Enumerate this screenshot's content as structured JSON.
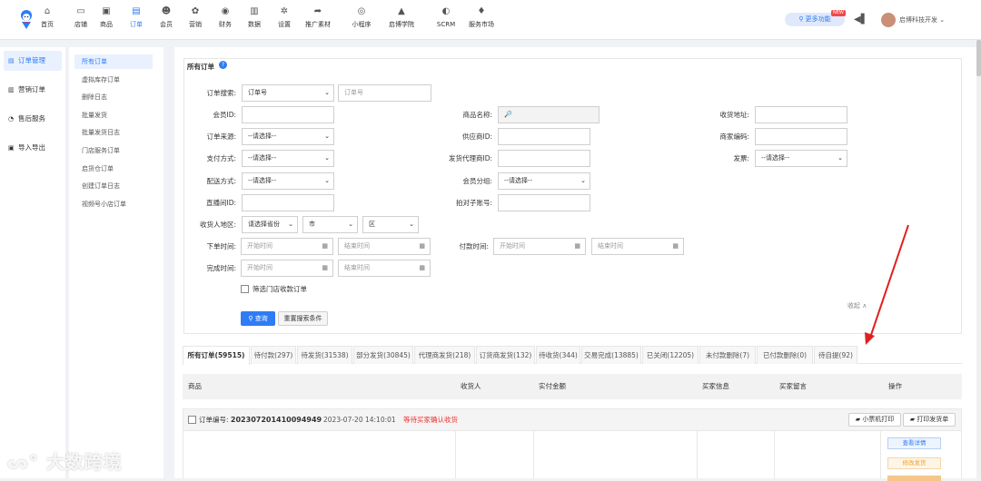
{
  "brand_colors": {
    "primary": "#2e7cf6",
    "danger": "#e33333",
    "warning": "#f0a020"
  },
  "topnav": [
    {
      "label": "首页",
      "icon": "home-icon"
    },
    {
      "label": "店铺",
      "icon": "store-icon"
    },
    {
      "label": "商品",
      "icon": "goods-icon"
    },
    {
      "label": "订单",
      "icon": "order-icon",
      "active": true
    },
    {
      "label": "会员",
      "icon": "member-icon"
    },
    {
      "label": "营销",
      "icon": "marketing-icon"
    },
    {
      "label": "财务",
      "icon": "finance-icon"
    },
    {
      "label": "数据",
      "icon": "chart-icon"
    },
    {
      "label": "设置",
      "icon": "gear-icon"
    },
    {
      "label": "推广素材",
      "icon": "share-icon"
    },
    {
      "label": "小程序",
      "icon": "miniapp-icon"
    },
    {
      "label": "启博学院",
      "icon": "academy-icon"
    },
    {
      "label": "SCRM",
      "icon": "scrm-icon"
    },
    {
      "label": "服务市场",
      "icon": "market-icon"
    }
  ],
  "header": {
    "more_features": "更多功能",
    "new_badge": "NEW",
    "user": "启博科技开发"
  },
  "leftmenu": [
    {
      "label": "订单管理",
      "active": true
    },
    {
      "label": "营销订单"
    },
    {
      "label": "售后服务"
    },
    {
      "label": "导入导出"
    }
  ],
  "submenu": [
    "所有订单",
    "虚拟库存订单",
    "删除日志",
    "批量发货",
    "批量发货日志",
    "门店服务订单",
    "启货仓订单",
    "创建订单日志",
    "视频号小店订单"
  ],
  "panel": {
    "title": "所有订单"
  },
  "filters": {
    "order_search": "订单搜索:",
    "order_search_type": "订单号",
    "order_search_ph": "订单号",
    "member_id": "会员ID:",
    "goods_name": "商品名称:",
    "address": "收货地址:",
    "order_source": "订单来源:",
    "supplier_id": "供应商ID:",
    "merchant_code": "商家编码:",
    "pay_method": "支付方式:",
    "agent_id": "发货代理商ID:",
    "invoice": "发票:",
    "delivery": "配送方式:",
    "member_group": "会员分组:",
    "live_id": "直播间ID:",
    "sub_account": "拍对子账号:",
    "region": "收货人地区:",
    "province": "请选择省份",
    "city": "市",
    "district": "区",
    "order_time": "下单时间:",
    "pay_time": "付款时间:",
    "finish_time": "完成时间:",
    "start_ph": "开始时间",
    "end_ph": "结束时间",
    "please_select": "--请选择--",
    "store_pickup": "筛选门店收款订单",
    "collapse": "收起 ∧",
    "search_btn": "查询",
    "reset_btn": "重置搜索条件"
  },
  "tabs": [
    "所有订单(59515)",
    "待付款(297)",
    "待发货(31538)",
    "部分发货(30845)",
    "代理商发货(218)",
    "订货商发货(132)",
    "待收货(344)",
    "交易完成(13885)",
    "已关闭(12205)",
    "未付款删除(7)",
    "已付款删除(0)",
    "待自提(92)"
  ],
  "table_headers": [
    "商品",
    "收货人",
    "实付金额",
    "买家信息",
    "买家留言",
    "操作"
  ],
  "order": {
    "no_label": "订单编号:",
    "no": "202307201410094949",
    "date": "2023-07-20 14:10:01",
    "status": "等待买家确认收货",
    "print_small": "小票机打印",
    "print_ship": "打印发货单",
    "view_detail": "查看详情",
    "modify_ship": "修改发货"
  },
  "watermark": "大数跨境"
}
